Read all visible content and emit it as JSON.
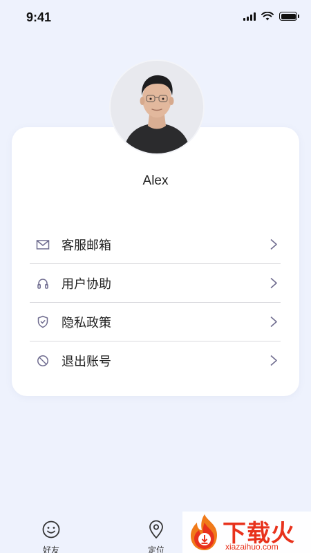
{
  "status_bar": {
    "time": "9:41"
  },
  "profile": {
    "name": "Alex"
  },
  "menu": {
    "items": [
      {
        "label": "客服邮箱",
        "icon": "mail-icon"
      },
      {
        "label": "用户协助",
        "icon": "headphones-icon"
      },
      {
        "label": "隐私政策",
        "icon": "shield-check-icon"
      },
      {
        "label": "退出账号",
        "icon": "block-icon"
      }
    ]
  },
  "tabbar": {
    "tabs": [
      {
        "label": "好友",
        "icon": "smile-icon"
      },
      {
        "label": "定位",
        "icon": "location-pin-icon"
      }
    ]
  },
  "watermark": {
    "brand": "下载火",
    "site": "xiazaihuo.com"
  },
  "colors": {
    "background": "#eef2fd",
    "card": "#ffffff",
    "icon": "#6f6c8f",
    "watermark": "#e8321c"
  }
}
